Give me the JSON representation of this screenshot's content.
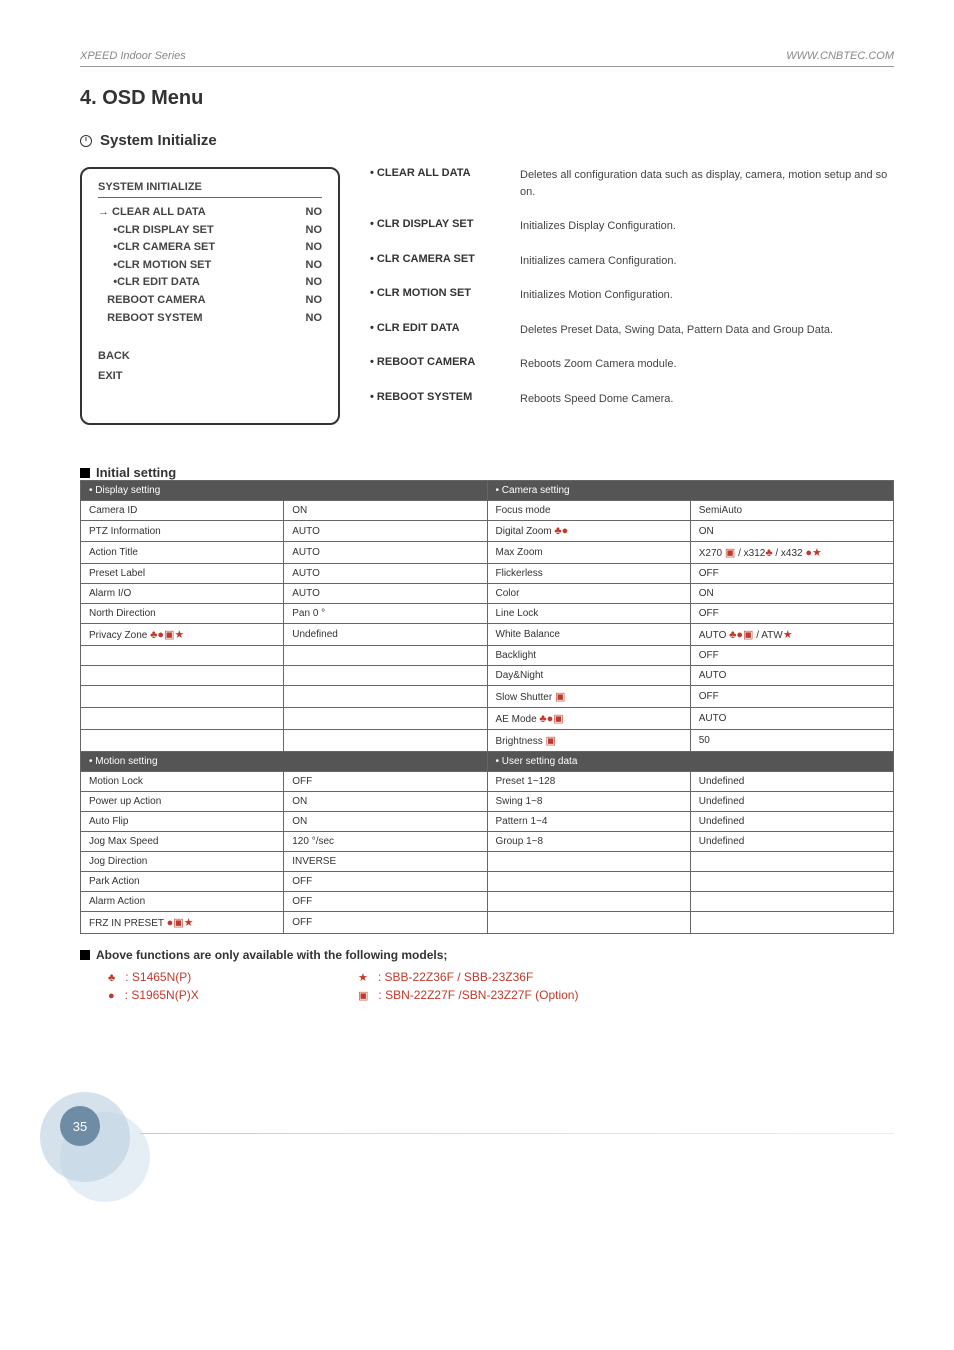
{
  "header": {
    "left": "XPEED Indoor Series",
    "right": "WWW.CNBTEC.COM"
  },
  "title": "4. OSD Menu",
  "section": "System Initialize",
  "osdBox": {
    "title": "SYSTEM INITIALIZE",
    "items": [
      {
        "label": "→ CLEAR ALL DATA",
        "val": "NO"
      },
      {
        "label": "     •CLR DISPLAY SET",
        "val": "NO"
      },
      {
        "label": "     •CLR CAMERA SET",
        "val": "NO"
      },
      {
        "label": "     •CLR MOTION SET",
        "val": "NO"
      },
      {
        "label": "     •CLR EDIT DATA",
        "val": "NO"
      },
      {
        "label": "   REBOOT CAMERA",
        "val": "NO"
      },
      {
        "label": "   REBOOT SYSTEM",
        "val": "NO"
      }
    ],
    "footer": [
      "BACK",
      "EXIT"
    ]
  },
  "descriptions": [
    {
      "label": "• CLEAR ALL DATA",
      "text": "Deletes all configuration data such as display, camera, motion setup and so on."
    },
    {
      "label": "• CLR DISPLAY SET",
      "text": "Initializes Display Configuration."
    },
    {
      "label": "• CLR CAMERA SET",
      "text": "Initializes camera Configuration."
    },
    {
      "label": "• CLR MOTION SET",
      "text": "Initializes Motion Configuration."
    },
    {
      "label": "• CLR EDIT DATA",
      "text": "Deletes Preset Data, Swing Data, Pattern Data and Group Data."
    },
    {
      "label": "• REBOOT CAMERA",
      "text": "Reboots Zoom Camera module."
    },
    {
      "label": "• REBOOT SYSTEM",
      "text": "Reboots Speed Dome Camera."
    }
  ],
  "initialSettingTitle": "Initial setting",
  "tableHeaders": {
    "display": "• Display setting",
    "camera": "• Camera setting",
    "motion": "• Motion setting",
    "user": "• User setting data"
  },
  "display": [
    {
      "k": "Camera ID",
      "v": "ON"
    },
    {
      "k": "PTZ Information",
      "v": "AUTO"
    },
    {
      "k": "Action Title",
      "v": "AUTO"
    },
    {
      "k": "Preset Label",
      "v": "AUTO"
    },
    {
      "k": "Alarm I/O",
      "v": "AUTO"
    },
    {
      "k": "North Direction",
      "v": "Pan 0 °"
    },
    {
      "k": "Privacy Zone",
      "ksym": "♣●▣★",
      "v": "Undefined"
    }
  ],
  "camera": [
    {
      "k": "Focus mode",
      "v": "SemiAuto"
    },
    {
      "k": "Digital Zoom",
      "ksym": "♣●",
      "v": "ON"
    },
    {
      "k": "Max Zoom",
      "v": "X270",
      "vsym": "▣ / x312♣ / x432 ●★"
    },
    {
      "k": "Flickerless",
      "v": "OFF"
    },
    {
      "k": "Color",
      "v": "ON"
    },
    {
      "k": "Line Lock",
      "v": "OFF"
    },
    {
      "k": "White Balance",
      "v": "AUTO",
      "vsym": "♣●▣ / ATW★"
    },
    {
      "k": "Backlight",
      "v": "OFF"
    },
    {
      "k": "Day&Night",
      "v": "AUTO"
    },
    {
      "k": "Slow Shutter",
      "ksym": "▣",
      "v": "OFF"
    },
    {
      "k": "AE Mode",
      "ksym": "♣●▣",
      "v": "AUTO"
    },
    {
      "k": "Brightness",
      "ksym": "▣",
      "v": "50"
    }
  ],
  "motion": [
    {
      "k": "Motion Lock",
      "v": "OFF"
    },
    {
      "k": "Power up Action",
      "v": "ON"
    },
    {
      "k": "Auto Flip",
      "v": "ON"
    },
    {
      "k": "Jog Max Speed",
      "v": "120 °/sec"
    },
    {
      "k": "Jog Direction",
      "v": "INVERSE"
    },
    {
      "k": "Park Action",
      "v": "OFF"
    },
    {
      "k": "Alarm Action",
      "v": "OFF"
    },
    {
      "k": "FRZ IN PRESET",
      "ksym": "●▣★",
      "v": "OFF"
    }
  ],
  "user": [
    {
      "k": "Preset 1~128",
      "v": "Undefined"
    },
    {
      "k": "Swing 1~8",
      "v": "Undefined"
    },
    {
      "k": "Pattern 1~4",
      "v": "Undefined"
    },
    {
      "k": "Group 1~8",
      "v": "Undefined"
    }
  ],
  "footnote": "Above functions are only available with the following models;",
  "legend": [
    {
      "sym": "♣",
      "text": ": S1465N(P)",
      "sym2": "★",
      "text2": ": SBB-22Z36F / SBB-23Z36F"
    },
    {
      "sym": "●",
      "text": ": S1965N(P)X",
      "sym2": "▣",
      "text2": ": SBN-22Z27F /SBN-23Z27F (Option)"
    }
  ],
  "pageNumber": "35"
}
